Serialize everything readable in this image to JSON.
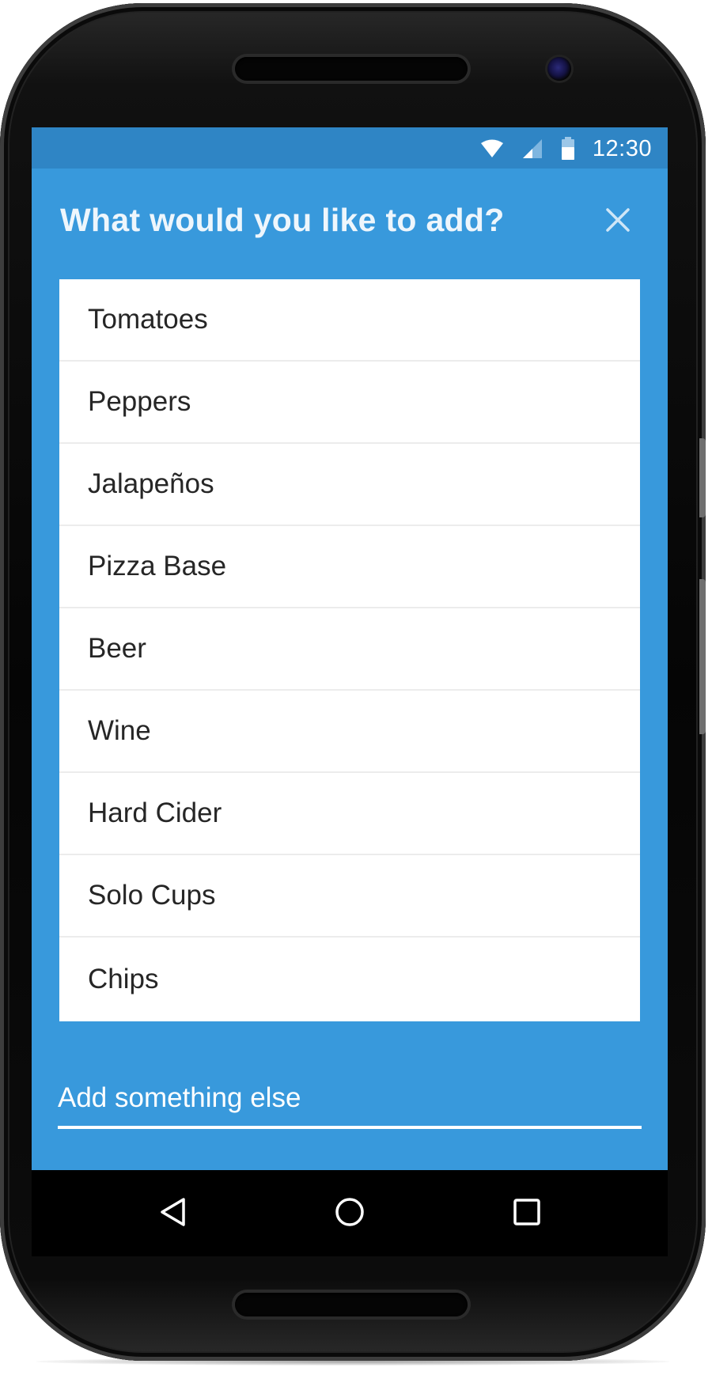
{
  "status_bar": {
    "time": "12:30",
    "icons": [
      "wifi-icon",
      "cellular-signal-icon",
      "battery-icon"
    ]
  },
  "dialog": {
    "title": "What would you like to add?",
    "close_icon": "close-icon",
    "items": [
      {
        "label": "Tomatoes"
      },
      {
        "label": "Peppers"
      },
      {
        "label": "Jalapeños"
      },
      {
        "label": "Pizza Base"
      },
      {
        "label": "Beer"
      },
      {
        "label": "Wine"
      },
      {
        "label": "Hard Cider"
      },
      {
        "label": "Solo Cups"
      },
      {
        "label": "Chips"
      }
    ],
    "add_field": {
      "placeholder": "Add something else",
      "value": ""
    }
  },
  "nav_bar": {
    "icons": [
      "back-icon",
      "home-icon",
      "recents-icon"
    ]
  },
  "colors": {
    "accent": "#3899dc",
    "status_bar": "#2f85c5",
    "list_background": "#ffffff",
    "list_text": "#262626",
    "divider": "#ececec",
    "nav_bar": "#000000"
  }
}
